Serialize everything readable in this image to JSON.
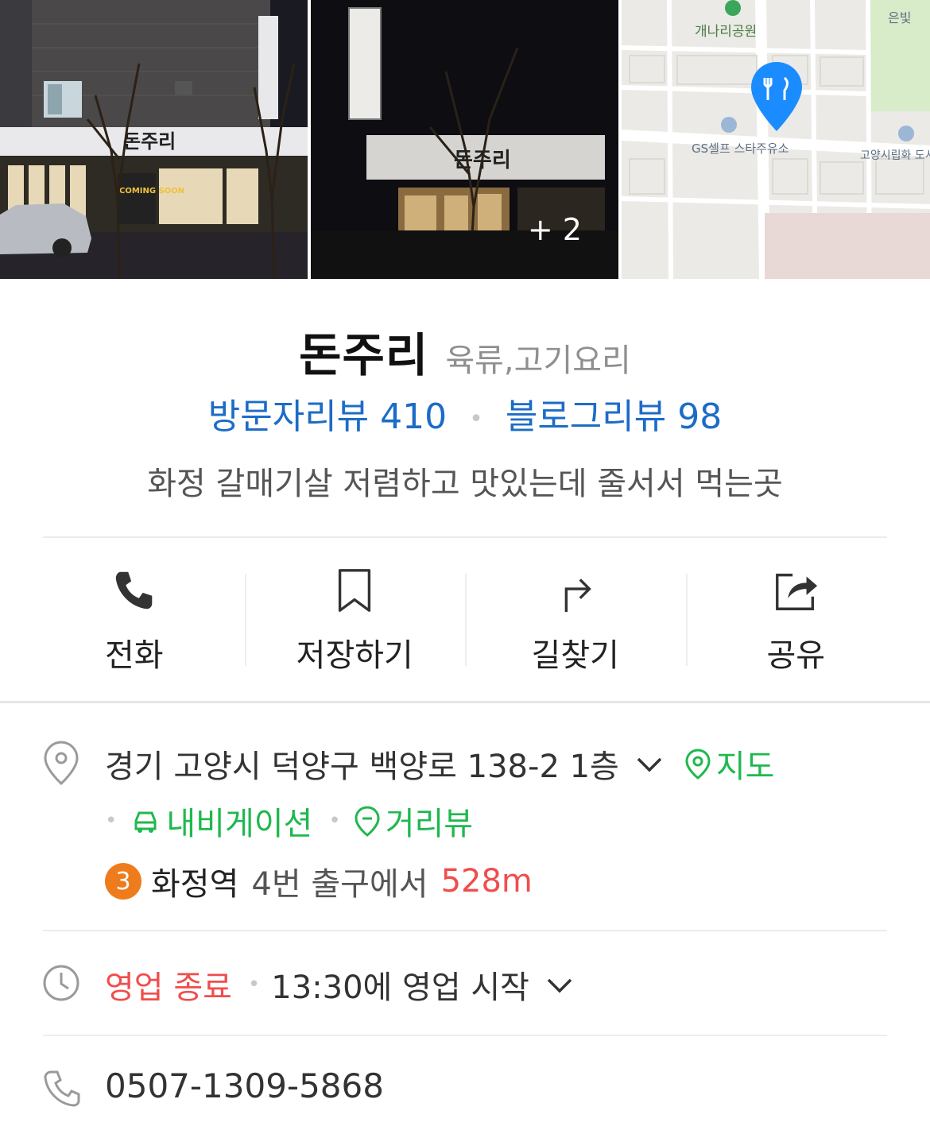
{
  "gallery": {
    "photo1_sign": "돈주리",
    "photo1_window_text": "COMING SOON",
    "photo2_sign": "돈주리",
    "more_count": "+ 2",
    "map_labels": {
      "park": "개나리공원",
      "station": "GS셀프 스타주유소",
      "library": "고양시립화 도서관",
      "top_right": "은빛"
    }
  },
  "place": {
    "name": "돈주리",
    "category": "육류,고기요리",
    "visitor_review": "방문자리뷰 410",
    "blog_review": "블로그리뷰 98",
    "description": "화정 갈매기살 저렴하고 맛있는데 줄서서 먹는곳"
  },
  "actions": [
    {
      "label": "전화",
      "icon": "phone-icon"
    },
    {
      "label": "저장하기",
      "icon": "bookmark-icon"
    },
    {
      "label": "길찾기",
      "icon": "directions-icon"
    },
    {
      "label": "공유",
      "icon": "share-icon"
    }
  ],
  "address": {
    "text": "경기 고양시 덕양구 백양로 138-2 1층",
    "map_link": "지도",
    "navigation_link": "내비게이션",
    "street_view_link": "거리뷰",
    "subway_line": "3",
    "subway_station": "화정역",
    "subway_exit": "4번 출구에서",
    "subway_distance": "528m"
  },
  "hours": {
    "status": "영업 종료",
    "next_open": "13:30에 영업 시작"
  },
  "phone": {
    "number": "0507-1309-5868"
  },
  "colors": {
    "link_blue": "#1c6cc7",
    "accent_green": "#1fb84e",
    "alert_red": "#f14d4d",
    "line3_orange": "#ef7c1c",
    "map_pin_blue": "#1a8cff"
  }
}
